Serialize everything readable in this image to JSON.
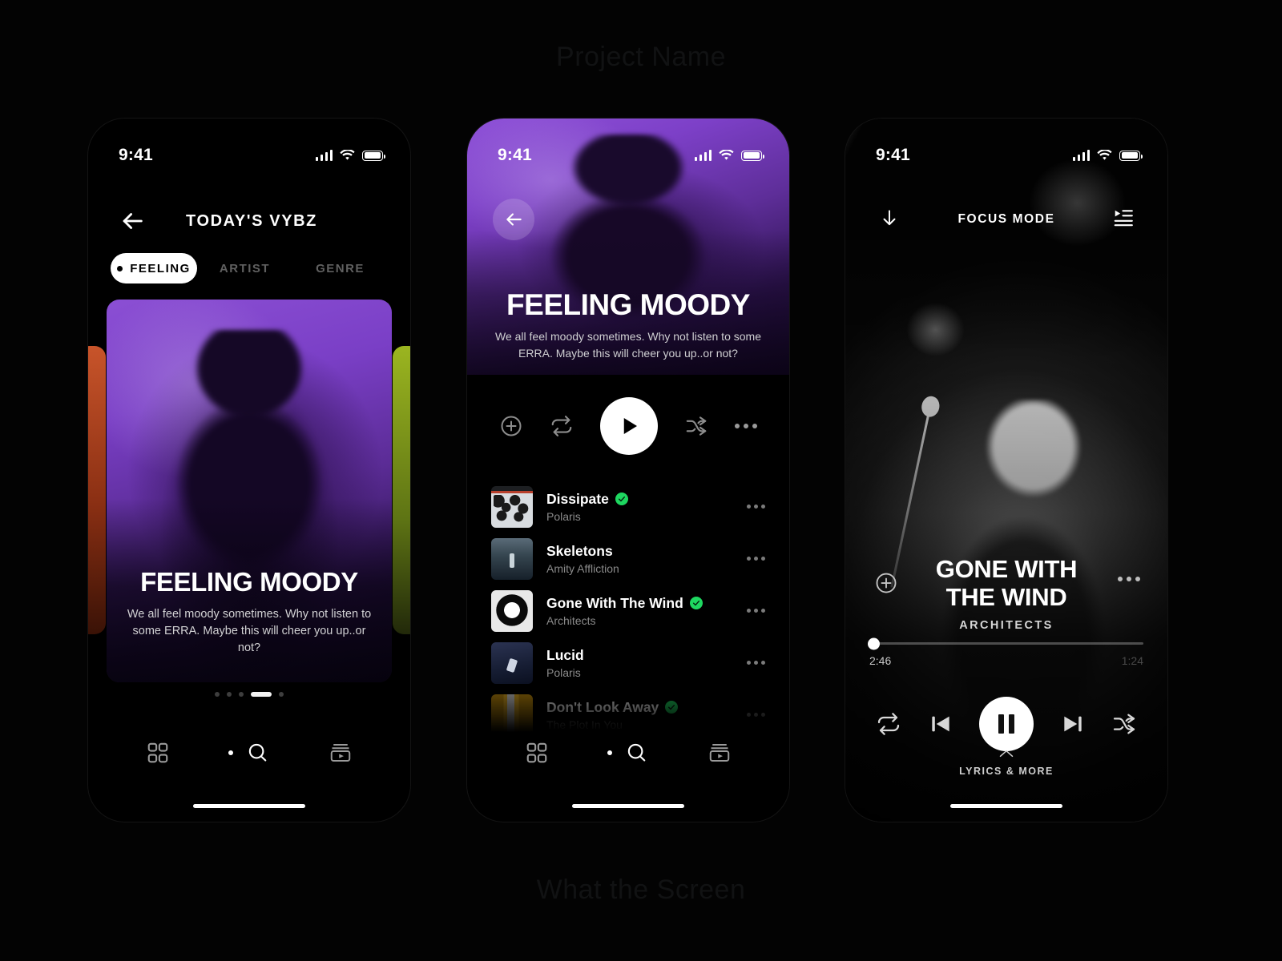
{
  "background": {
    "watermark_top": "Project Name",
    "watermark_bottom": "What the Screen"
  },
  "colors": {
    "accent_purple": "#8b4fd4",
    "verified_green": "#1ed760",
    "white": "#ffffff",
    "muted": "#8a8a8a"
  },
  "status_bar": {
    "time": "9:41"
  },
  "phone1": {
    "nav": {
      "back_icon": "arrow-left-icon",
      "title": "TODAY'S VYBZ"
    },
    "tabs": [
      {
        "label": "FEELING",
        "active": true
      },
      {
        "label": "ARTIST",
        "active": false
      },
      {
        "label": "GENRE",
        "active": false
      }
    ],
    "card": {
      "title": "FEELING MOODY",
      "subtitle": "We all feel moody sometimes.  Why not listen to some ERRA.  Maybe this will cheer you up..or not?"
    },
    "pagination": {
      "count": 5,
      "active_index": 3
    },
    "tabbar": [
      {
        "name": "grid-icon",
        "label": "Browse",
        "active": false
      },
      {
        "name": "search-icon",
        "label": "Search",
        "active": true
      },
      {
        "name": "library-icon",
        "label": "Library",
        "active": false
      }
    ]
  },
  "phone2": {
    "back_icon": "arrow-left-icon",
    "hero": {
      "title": "FEELING MOODY",
      "subtitle": "We all feel moody sometimes.  Why not listen to some ERRA.  Maybe this will cheer you up..or not?"
    },
    "controls": [
      {
        "name": "add-icon",
        "label": "Add"
      },
      {
        "name": "repeat-icon",
        "label": "Repeat"
      },
      {
        "name": "play-icon",
        "label": "Play"
      },
      {
        "name": "shuffle-icon",
        "label": "Shuffle"
      },
      {
        "name": "more-icon",
        "label": "More"
      }
    ],
    "tracks": [
      {
        "title": "Dissipate",
        "artist": "Polaris",
        "verified": true
      },
      {
        "title": "Skeletons",
        "artist": "Amity Affliction",
        "verified": false
      },
      {
        "title": "Gone With The Wind",
        "artist": "Architects",
        "verified": true
      },
      {
        "title": "Lucid",
        "artist": "Polaris",
        "verified": false
      },
      {
        "title": "Don't Look Away",
        "artist": "The Plot In You",
        "verified": true
      }
    ],
    "tabbar": [
      {
        "name": "grid-icon",
        "label": "Browse",
        "active": false
      },
      {
        "name": "search-icon",
        "label": "Search",
        "active": true
      },
      {
        "name": "library-icon",
        "label": "Library",
        "active": false
      }
    ]
  },
  "phone3": {
    "nav": {
      "minimize_icon": "arrow-down-icon",
      "title": "FOCUS MODE",
      "queue_icon": "queue-list-icon"
    },
    "now_playing": {
      "title_line1": "GONE WITH",
      "title_line2": "THE WIND",
      "artist": "ARCHITECTS",
      "add_icon": "plus-circle-icon",
      "more_icon": "more-icon"
    },
    "progress": {
      "elapsed": "2:46",
      "remaining": "1:24",
      "percent": 0
    },
    "controls": [
      {
        "name": "repeat-icon",
        "label": "Repeat"
      },
      {
        "name": "previous-icon",
        "label": "Previous"
      },
      {
        "name": "pause-icon",
        "label": "Pause"
      },
      {
        "name": "next-icon",
        "label": "Next"
      },
      {
        "name": "shuffle-icon",
        "label": "Shuffle"
      }
    ],
    "lyrics": {
      "chevron_icon": "chevron-up-icon",
      "label": "LYRICS & MORE"
    }
  }
}
